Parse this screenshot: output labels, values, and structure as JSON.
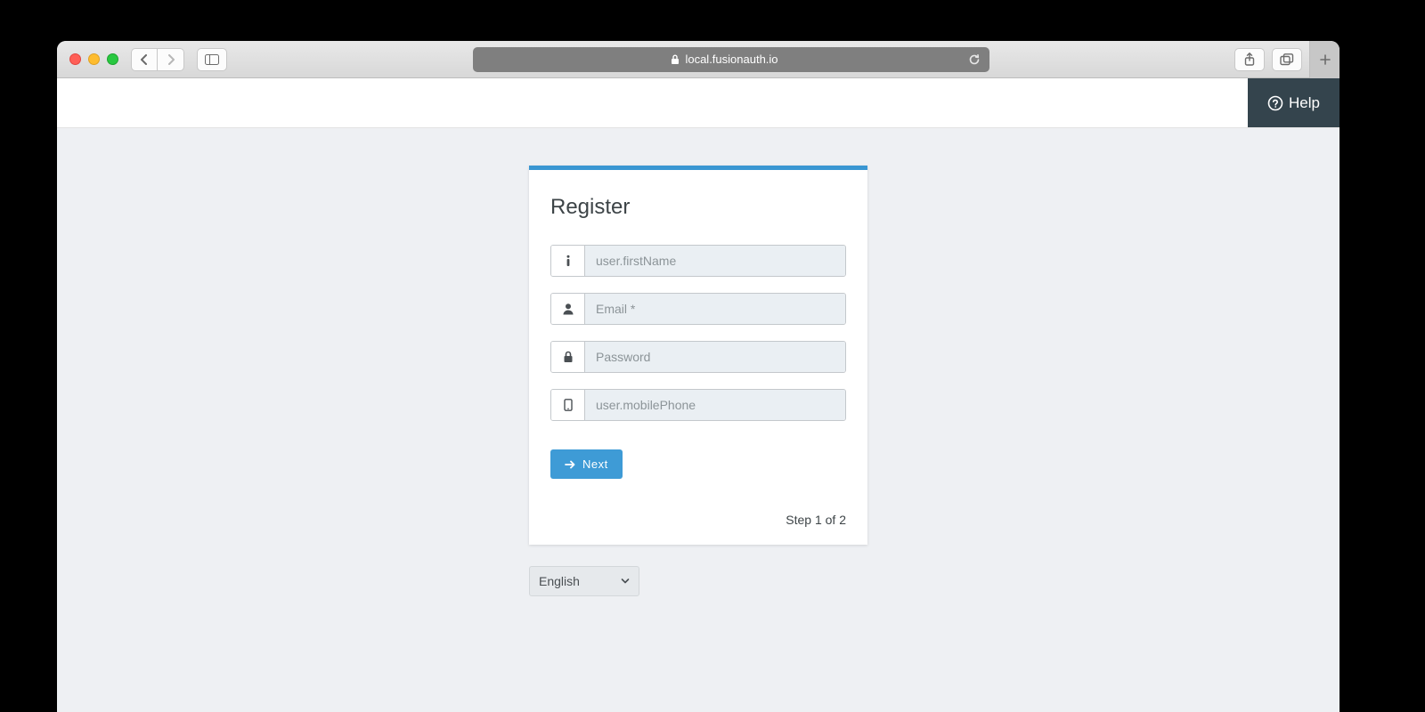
{
  "browser": {
    "address": "local.fusionauth.io"
  },
  "header": {
    "help_label": "Help"
  },
  "card": {
    "title": "Register",
    "fields": {
      "firstName": {
        "placeholder": "user.firstName",
        "value": ""
      },
      "email": {
        "placeholder": "Email *",
        "value": ""
      },
      "password": {
        "placeholder": "Password",
        "value": ""
      },
      "phone": {
        "placeholder": "user.mobilePhone",
        "value": ""
      }
    },
    "next_label": "Next",
    "step_label": "Step 1 of 2"
  },
  "language": {
    "selected": "English"
  }
}
